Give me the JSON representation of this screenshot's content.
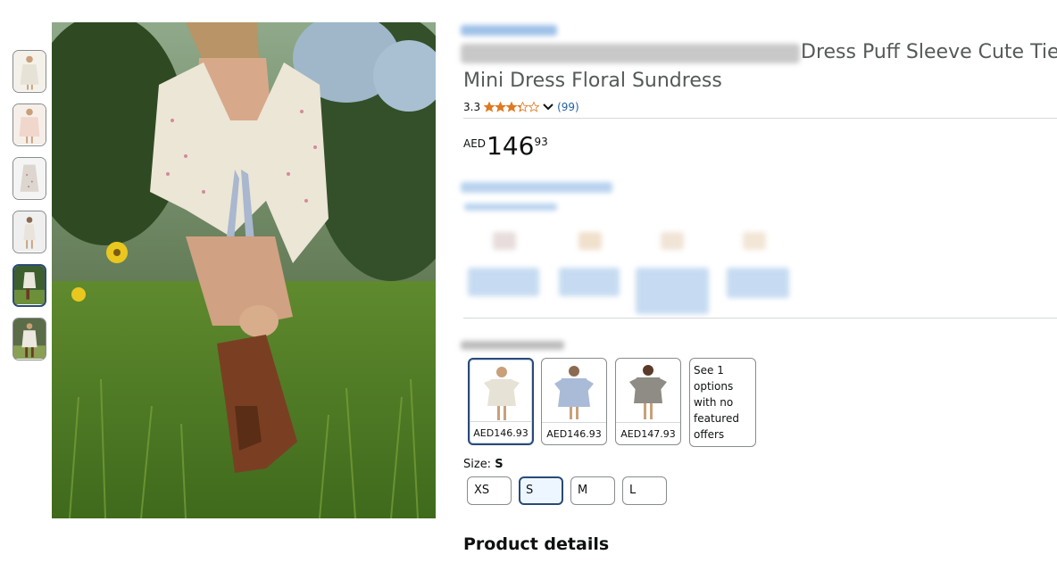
{
  "product": {
    "title_line1_visible": "Dress Puff Sleeve Cute Tie",
    "title_line2": "Mini Dress Floral Sundress",
    "rating": "3.3",
    "rating_stars": 3.3,
    "rating_count": "(99)"
  },
  "price": {
    "currency": "AED",
    "whole": "146",
    "fraction": "93"
  },
  "thumbnails": [
    {
      "name": "thumb-1"
    },
    {
      "name": "thumb-2"
    },
    {
      "name": "thumb-3"
    },
    {
      "name": "thumb-4"
    },
    {
      "name": "thumb-5"
    },
    {
      "name": "thumb-6"
    }
  ],
  "style_options": [
    {
      "price": "AED146.93",
      "selected": true
    },
    {
      "price": "AED146.93",
      "selected": false
    },
    {
      "price": "AED147.93",
      "selected": false
    }
  ],
  "more_options_text": "See 1 options with no featured offers",
  "size": {
    "label": "Size:",
    "selected": "S",
    "options": [
      "XS",
      "S",
      "M",
      "L"
    ]
  },
  "product_details_heading": "Product details",
  "colors": {
    "accent_blue": "#2a4a78",
    "link_blue": "#2162a1",
    "star_orange": "#de7921"
  },
  "icons": {
    "share": "share-icon",
    "chevron": "chevron-down-icon"
  }
}
